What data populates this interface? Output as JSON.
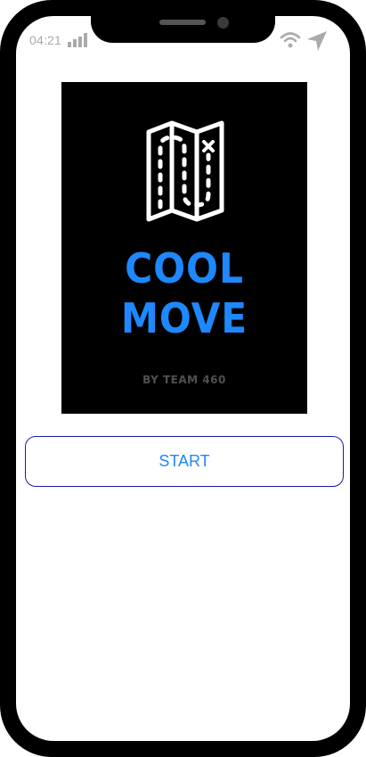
{
  "status_bar": {
    "time": "04:21",
    "icons": [
      "signal-bars-icon",
      "wifi-icon",
      "location-arrow-icon"
    ]
  },
  "splash": {
    "icon": "folded-map-icon",
    "title_line_1": "COOL",
    "title_line_2": "MOVE",
    "byline": "BY TEAM 460"
  },
  "actions": {
    "start_label": "START"
  },
  "colors": {
    "accent": "#1e88ff",
    "button_border": "#1a1ab0",
    "splash_background": "#000000",
    "byline": "#505050"
  }
}
